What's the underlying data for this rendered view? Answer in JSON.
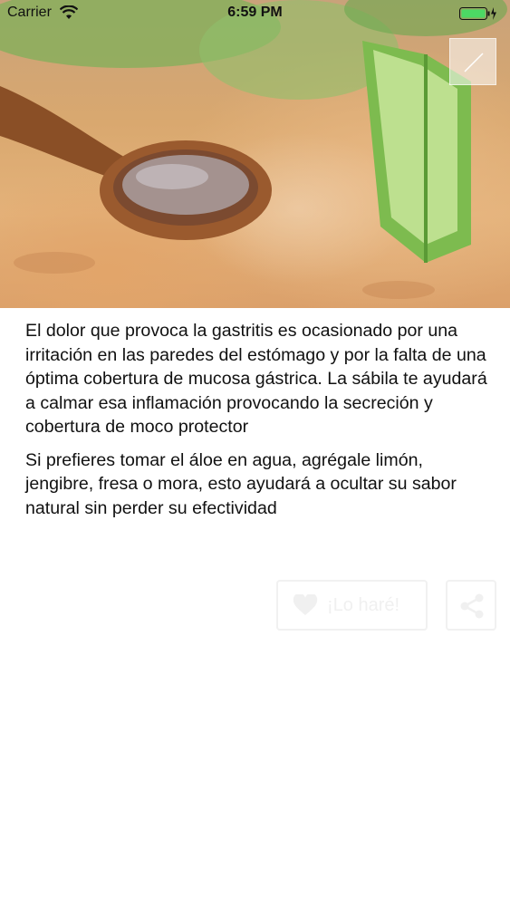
{
  "status_bar": {
    "carrier": "Carrier",
    "time": "6:59 PM"
  },
  "hero": {
    "icon": "close-icon"
  },
  "article": {
    "paragraphs": [
      "El dolor que provoca la gastritis es ocasionado por una irritación en las paredes del estómago y por la falta de una óptima cobertura de mucosa gástrica. La sábila te ayudará a calmar esa inflamación provocando la secreción y cobertura de moco protector",
      "Si prefieres tomar el áloe en agua, agrégale limón, jengibre, fresa o mora, esto ayudará a ocultar su sabor natural sin perder su efectividad"
    ]
  },
  "actions": {
    "do_it_label": "¡Lo haré!",
    "do_it_icon": "heart-icon",
    "share_icon": "share-icon"
  },
  "colors": {
    "battery": "#4cd964",
    "button_border": "#f1f1f1",
    "button_text": "#f0f0f0"
  }
}
